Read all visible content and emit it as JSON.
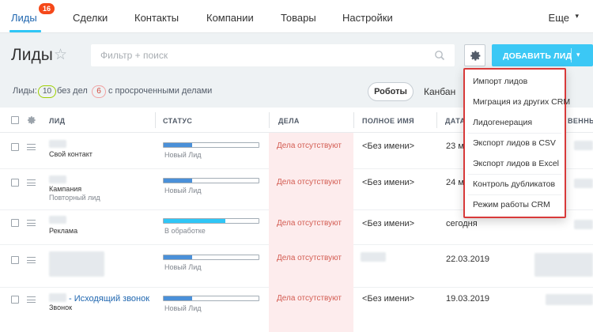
{
  "nav": {
    "items": [
      {
        "label": "Лиды",
        "badge": "16",
        "active": true
      },
      {
        "label": "Сделки"
      },
      {
        "label": "Контакты"
      },
      {
        "label": "Компании"
      },
      {
        "label": "Товары"
      },
      {
        "label": "Настройки"
      }
    ],
    "more": "Еще"
  },
  "page": {
    "title": "Лиды",
    "filter_placeholder": "Фильтр + поиск",
    "add_button": "ДОБАВИТЬ ЛИД"
  },
  "counters": {
    "label": "Лиды:",
    "no_deals_count": "10",
    "no_deals_label": "без дел",
    "overdue_count": "6",
    "overdue_label": "с просроченными делами"
  },
  "views": {
    "robots": "Роботы",
    "kanban": "Канбан"
  },
  "table": {
    "columns": [
      "ЛИД",
      "СТАТУС",
      "ДЕЛА",
      "ПОЛНОЕ ИМЯ",
      "ДАТА",
      "ВЕННЫ"
    ],
    "rows": [
      {
        "source": "Свой контакт",
        "status": "Новый Лид",
        "status_progress": 0.3,
        "deals": "Дела отсутствуют",
        "full_name": "<Без имени>",
        "date": "23 м"
      },
      {
        "source": "Кампания",
        "source2": "Повторный лид",
        "status": "Новый Лид",
        "status_progress": 0.3,
        "deals": "Дела отсутствуют",
        "full_name": "<Без имени>",
        "date": "24 м"
      },
      {
        "source": "Реклама",
        "status": "В обработке",
        "status_progress": 0.65,
        "deals": "Дела отсутствуют",
        "full_name": "<Без имени>",
        "date": "сегодня"
      },
      {
        "source": "",
        "status": "Новый Лид",
        "status_progress": 0.3,
        "deals": "Дела отсутствуют",
        "full_name": "",
        "date": "22.03.2019"
      },
      {
        "link": "- Исходящий звонок",
        "source": "Звонок",
        "status": "Новый Лид",
        "status_progress": 0.3,
        "deals": "Дела отсутствуют",
        "full_name": "<Без имени>",
        "date": "19.03.2019"
      }
    ]
  },
  "menu": {
    "items": [
      "Импорт лидов",
      "Миграция из других CRM",
      "Лидогенерация",
      "Экспорт лидов в CSV",
      "Экспорт лидов в Excel",
      "Контроль дубликатов",
      "Режим работы CRM"
    ]
  },
  "colors": {
    "accent": "#3bc8f5",
    "link": "#2067b0",
    "badge": "#f54819",
    "menu_border": "#d83a3a",
    "status_fill": "#4a90d9"
  }
}
